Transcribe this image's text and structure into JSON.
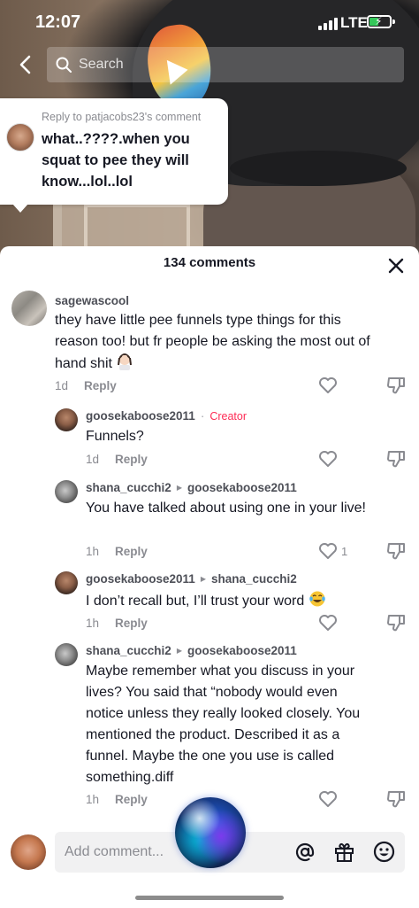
{
  "status_bar": {
    "time": "12:07",
    "network": "LTE",
    "battery_charging": true
  },
  "header": {
    "search_placeholder": "Search"
  },
  "reply_bubble": {
    "reply_to": "Reply to patjacobs23's comment",
    "text": "what..????.when you squat to pee they will know...lol..lol"
  },
  "comments_panel": {
    "title": "134 comments",
    "comments": [
      {
        "username": "sagewascool",
        "text": "they have little pee funnels type things for this reason too! but fr people be asking the most out of hand shit",
        "emoji": "woman-facepalming",
        "time": "1d",
        "reply_label": "Reply",
        "likes": ""
      },
      {
        "username": "goosekaboose2011",
        "creator_label": "Creator",
        "text": "Funnels?",
        "time": "1d",
        "reply_label": "Reply",
        "likes": ""
      },
      {
        "username": "shana_cucchi2",
        "reply_to_user": "goosekaboose2011",
        "text": "You have talked about using one in your live!",
        "time": "1h",
        "reply_label": "Reply",
        "likes": "1"
      },
      {
        "username": "goosekaboose2011",
        "reply_to_user": "shana_cucchi2",
        "text": "I don’t recall but, I’ll trust your word",
        "emoji": "face-with-tears-of-joy",
        "time": "1h",
        "reply_label": "Reply",
        "likes": ""
      },
      {
        "username": "shana_cucchi2",
        "reply_to_user": "goosekaboose2011",
        "text": "Maybe remember what you discuss in your lives? You said that “nobody would even notice unless they really looked closely. You mentioned the product. Described it as a funnel. Maybe the one you use is called something.diff",
        "time": "1h",
        "reply_label": "Reply",
        "likes": ""
      }
    ]
  },
  "bottom_bar": {
    "input_placeholder": "Add comment..."
  },
  "colors": {
    "creator": "#fe2c55",
    "muted": "#8a8b91",
    "text": "#161823"
  }
}
